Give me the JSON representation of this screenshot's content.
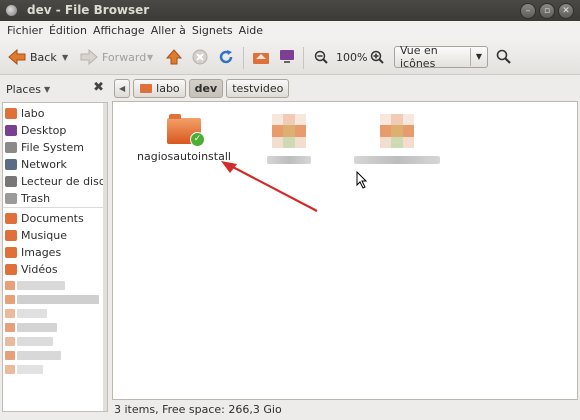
{
  "window": {
    "title": "dev - File Browser"
  },
  "menubar": [
    "Fichier",
    "Édition",
    "Affichage",
    "Aller à",
    "Signets",
    "Aide"
  ],
  "toolbar": {
    "back_label": "Back",
    "forward_label": "Forward",
    "zoom_level": "100%",
    "view_mode": "Vue en icônes"
  },
  "sidebar": {
    "header": "Places",
    "items": [
      {
        "label": "labo",
        "icon": "home-folder-icon",
        "color": "#e0703a"
      },
      {
        "label": "Desktop",
        "icon": "desktop-icon",
        "color": "#7a3f8e"
      },
      {
        "label": "File System",
        "icon": "harddisk-icon",
        "color": "#8a8a8a"
      },
      {
        "label": "Network",
        "icon": "network-icon",
        "color": "#5a6b85"
      },
      {
        "label": "Lecteur de disq…",
        "icon": "floppy-icon",
        "color": "#777777"
      },
      {
        "label": "Trash",
        "icon": "trash-icon",
        "color": "#9a9a9a"
      },
      {
        "label": "Documents",
        "icon": "folder-documents-icon",
        "color": "#e0703a"
      },
      {
        "label": "Musique",
        "icon": "folder-music-icon",
        "color": "#e0703a"
      },
      {
        "label": "Images",
        "icon": "folder-pictures-icon",
        "color": "#e0703a"
      },
      {
        "label": "Vidéos",
        "icon": "folder-videos-icon",
        "color": "#e0703a"
      }
    ]
  },
  "pathbar": {
    "segments": [
      {
        "label": "labo",
        "active": false
      },
      {
        "label": "dev",
        "active": true
      },
      {
        "label": "testvideo",
        "active": false
      }
    ]
  },
  "content": {
    "items": [
      {
        "label": "nagiosautoinstall",
        "type": "folder",
        "badge": "✓"
      }
    ]
  },
  "status": "3 items, Free space: 266,3 Gio",
  "colors": {
    "accent": "#e0703a",
    "arrow": "#d42a2a",
    "titlebar": "#3c3b37"
  }
}
